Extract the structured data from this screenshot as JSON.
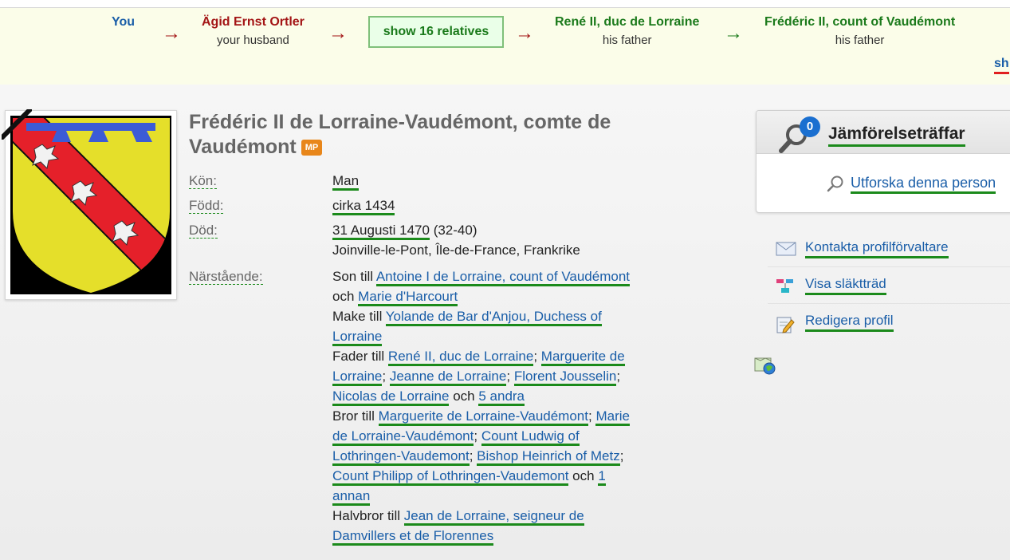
{
  "pathbar": {
    "nodes": [
      {
        "name": "You",
        "relation": ""
      },
      {
        "name": "Ägid Ernst Ortler",
        "relation": "your husband"
      },
      {
        "name": "René II, duc de Lorraine",
        "relation": "his father"
      },
      {
        "name": "Frédéric II, count of Vaudémont",
        "relation": "his father"
      }
    ],
    "arrow": "→",
    "show_relatives": "show 16 relatives",
    "cut_link": "sh"
  },
  "profile": {
    "name": "Frédéric II de Lorraine-Vaudémont, comte de Vaudémont",
    "badge": "MP",
    "fields": {
      "gender_label": "Kön:",
      "gender": "Man",
      "born_label": "Född:",
      "born": "cirka 1434",
      "died_label": "Död:",
      "died_date": "31 Augusti 1470",
      "died_age": "(32-40)",
      "died_place": "Joinville-le-Pont, Île-de-France, Frankrike",
      "relatives_label": "Närstående:"
    },
    "relatives": {
      "son_of": "Son till",
      "parent1": "Antoine I de Lorraine, count of Vaudémont",
      "and": "och",
      "parent2": "Marie d'Harcourt",
      "husband_of": "Make till",
      "spouse": "Yolande de Bar d'Anjou, Duchess of Lorraine",
      "father_of": "Fader till",
      "children": [
        "René II, duc de Lorraine",
        "Marguerite de Lorraine",
        "Jeanne de Lorraine",
        "Florent Jousselin",
        "Nicolas de Lorraine"
      ],
      "children_more": "5 andra",
      "brother_of": "Bror till",
      "siblings": [
        "Marguerite de Lorraine-Vaudémont",
        "Marie de Lorraine-Vaudémont",
        "Count Ludwig of Lothringen-Vaudemont",
        "Bishop Heinrich of Metz",
        "Count Philipp of Lothringen-Vaudemont"
      ],
      "siblings_more": "1 annan",
      "halfbrother_of": "Halvbror till",
      "halfsibling": "Jean de Lorraine, seigneur de Damvillers et de Florennes",
      "separator": ";"
    }
  },
  "sidebar": {
    "match_title": "Jämförelseträffar",
    "match_count": "0",
    "explore": "Utforska denna person",
    "actions": [
      {
        "label": "Kontakta profilförvaltare",
        "icon": "envelope-icon"
      },
      {
        "label": "Visa släktträd",
        "icon": "family-tree-icon"
      },
      {
        "label": "Redigera profil",
        "icon": "edit-profile-icon"
      }
    ]
  },
  "colors": {
    "you": "#1a5ea8",
    "husband": "#a31515",
    "ancestor": "#1b7a1b",
    "badge": "#e8861a",
    "link": "#1a5ea8",
    "underline": "#1b8a1b",
    "pathbar_bg": "#fbfde9"
  }
}
